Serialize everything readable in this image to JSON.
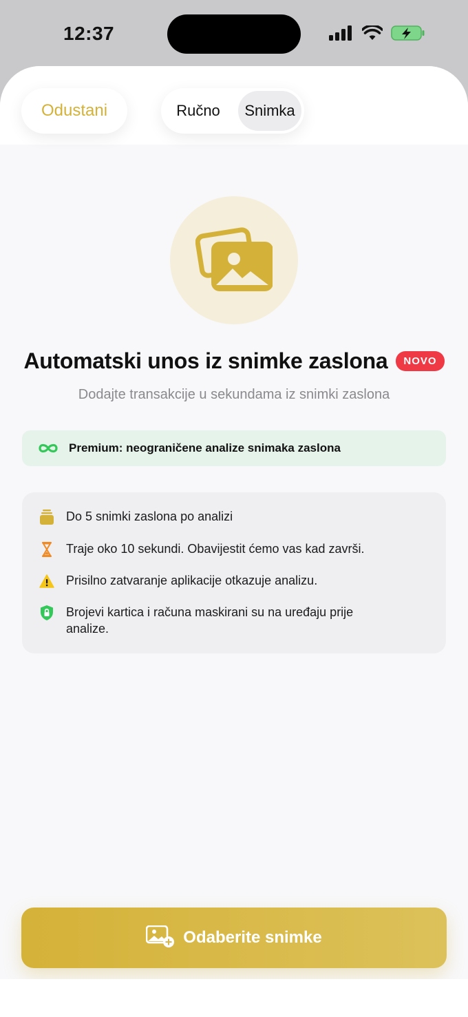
{
  "status_bar": {
    "time": "12:37"
  },
  "header": {
    "cancel_label": "Odustani",
    "segments": [
      {
        "label": "Ručno",
        "selected": false
      },
      {
        "label": "Snimka",
        "selected": true
      }
    ]
  },
  "hero": {
    "icon": "photos-icon",
    "title": "Automatski unos iz snimke zaslona",
    "badge": "NOVO",
    "subtitle": "Dodajte transakcije u sekundama iz snimki zaslona"
  },
  "premium_banner": {
    "icon": "infinity-icon",
    "text": "Premium: neograničene analize snimaka zaslona"
  },
  "info_items": [
    {
      "icon": "stack-icon",
      "text": "Do 5 snimki zaslona po analizi"
    },
    {
      "icon": "hourglass-icon",
      "text": "Traje oko 10 sekundi. Obavijestit ćemo vas kad završi."
    },
    {
      "icon": "warning-icon",
      "text": "Prisilno zatvaranje aplikacije otkazuje analizu."
    },
    {
      "icon": "shield-lock-icon",
      "text": "Brojevi kartica i računa maskirani su na uređaju prije analize."
    }
  ],
  "cta": {
    "icon": "add-photo-icon",
    "label": "Odaberite snimke"
  },
  "colors": {
    "accent": "#d4b23a",
    "badge": "#ef3a46",
    "premium_bg": "#e6f3ea",
    "premium_icon": "#34c759"
  }
}
